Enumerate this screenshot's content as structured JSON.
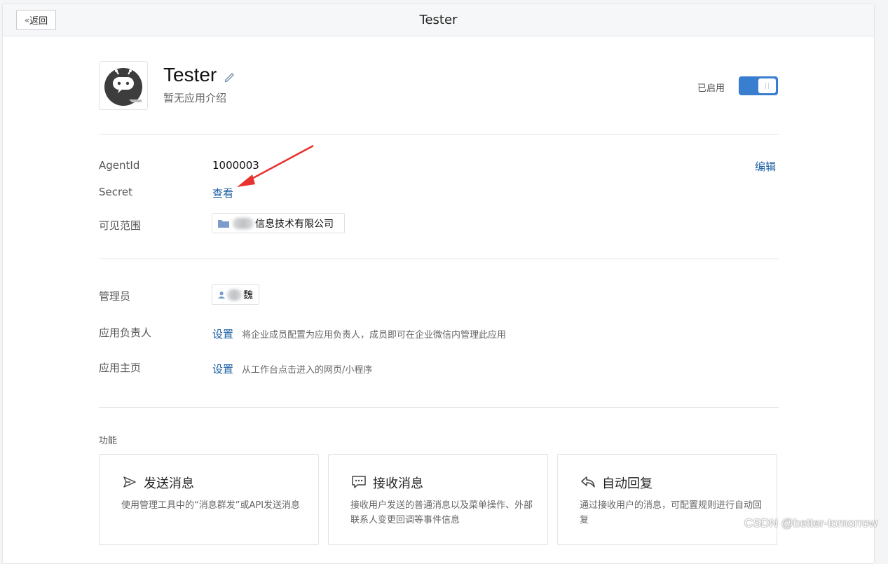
{
  "topbar": {
    "back_label": "返回",
    "title": "Tester"
  },
  "app": {
    "name": "Tester",
    "description": "暂无应用介绍",
    "status_label": "已启用",
    "enabled": true,
    "logo_icon": "robot-chat-icon",
    "edit_icon": "pencil-icon"
  },
  "info": {
    "agentid_label": "AgentId",
    "agentid_value": "1000003",
    "secret_label": "Secret",
    "secret_link": "查看",
    "visibility_label": "可见范围",
    "visibility_org": "信息技术有限公司",
    "edit_link": "编辑"
  },
  "management": {
    "admin_label": "管理员",
    "admin_name": "魏",
    "owner_label": "应用负责人",
    "owner_link": "设置",
    "owner_hint": "将企业成员配置为应用负责人，成员即可在企业微信内管理此应用",
    "homepage_label": "应用主页",
    "homepage_link": "设置",
    "homepage_hint": "从工作台点击进入的网页/小程序"
  },
  "features": {
    "section_title": "功能",
    "cards": [
      {
        "title": "发送消息",
        "icon": "send-icon",
        "desc": "使用管理工具中的“消息群发”或API发送消息"
      },
      {
        "title": "接收消息",
        "icon": "chat-bubble-icon",
        "desc": "接收用户发送的普通消息以及菜单操作、外部联系人变更回调等事件信息"
      },
      {
        "title": "自动回复",
        "icon": "reply-icon",
        "desc": "通过接收用户的消息，可配置规则进行自动回复"
      }
    ]
  },
  "watermark": "CSDN @better-tomorrow",
  "colors": {
    "link": "#1b5fa3",
    "toggle_on": "#3a7fcf",
    "annotation_arrow": "#e8322f"
  }
}
